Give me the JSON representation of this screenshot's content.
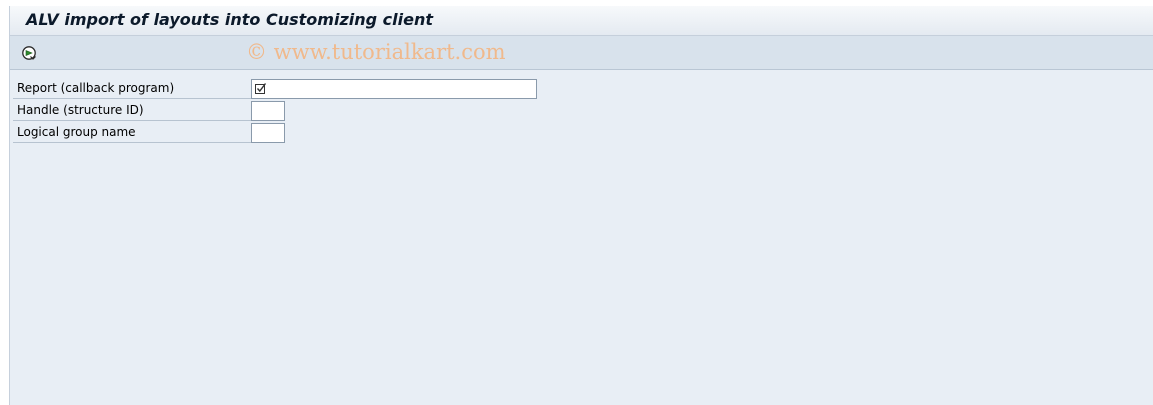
{
  "title": "ALV import of layouts into Customizing client",
  "toolbar": {
    "execute_icon": "execute-icon",
    "watermark": "© www.tutorialkart.com"
  },
  "form": {
    "fields": [
      {
        "label": "Report (callback program)",
        "value": "",
        "icon": "required-checkbox-icon"
      },
      {
        "label": "Handle (structure ID)",
        "value": ""
      },
      {
        "label": "Logical group name",
        "value": ""
      }
    ]
  },
  "colors": {
    "background": "#e8eef5",
    "toolbar": "#d8e2ec",
    "watermark": "#f0b98c"
  }
}
